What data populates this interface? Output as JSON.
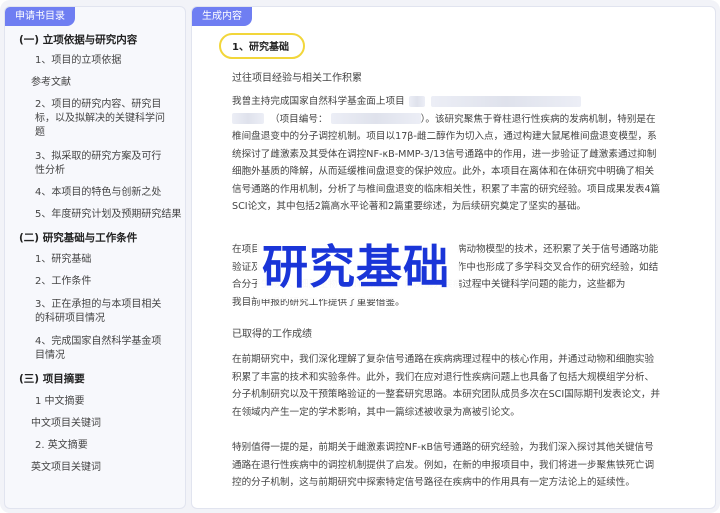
{
  "sidebar": {
    "tab_label": "申请书目录",
    "items": [
      {
        "text": "(一) 立项依据与研究内容",
        "kind": "section"
      },
      {
        "text": "1、项目的立项依据",
        "kind": "sub"
      },
      {
        "text": "参考文献",
        "kind": "ref"
      },
      {
        "text": "2、项目的研究内容、研究目标，以及拟解决的关键科学问题",
        "kind": "sub2"
      },
      {
        "text": "3、拟采取的研究方案及可行性分析",
        "kind": "sub2"
      },
      {
        "text": "4、本项目的特色与创新之处",
        "kind": "sub"
      },
      {
        "text": "5、年度研究计划及预期研究结果",
        "kind": "sub"
      },
      {
        "text": "(二) 研究基础与工作条件",
        "kind": "section"
      },
      {
        "text": "1、研究基础",
        "kind": "sub"
      },
      {
        "text": "2、工作条件",
        "kind": "sub"
      },
      {
        "text": "3、正在承担的与本项目相关的科研项目情况",
        "kind": "sub2"
      },
      {
        "text": "4、完成国家自然科学基金项目情况",
        "kind": "sub2"
      },
      {
        "text": "(三) 项目摘要",
        "kind": "section"
      },
      {
        "text": "1 中文摘要",
        "kind": "sub"
      },
      {
        "text": "中文项目关键词",
        "kind": "ref"
      },
      {
        "text": "2. 英文摘要",
        "kind": "sub"
      },
      {
        "text": "英文项目关键词",
        "kind": "ref"
      }
    ]
  },
  "main": {
    "tab_label": "生成内容",
    "heading": "1、研究基础",
    "subhead1": "过往项目经验与相关工作积累",
    "p1_lines": [
      "我曾主持完成国家自然科学基金面上项目",
      "（项目编号：",
      "）。该研究聚焦于脊柱退行性疾病的发病机制，特别是在",
      "椎间盘退变中的分子调控机制。项目以17β-雌二醇作为切入点，通过构建大鼠尾椎间盘退变模型，系",
      "统探讨了雌激素及其受体在调控NF-κB-MMP-3/13信号通路中的作用，进一步验证了雌激素通过抑制",
      "细胞外基质的降解，从而延缓椎间盘退变的保护效应。此外，本项目在离体和在体研究中明确了相关",
      "信号通路的作用机制，分析了与椎间盘退变的临床相关性，积累了丰富的研究经验。项目成果发表4篇",
      "SCI论文，其中包括2篇高水平论著和2篇重要综述，为后续研究奠定了坚实的基础。"
    ],
    "p2_lines": [
      "在项目",
      "病动物模型的技术，还积累了关于信号通路功能",
      "验证及",
      "作中也形成了多学科交叉合作的研究经验，如结",
      "合分子生物学、细胞生物学和临床医学，解决重大疾病过程中关键科学问题的能力，这些都为",
      "我目前申报的研究工作提供了重要借鉴。"
    ],
    "subhead2": "已取得的工作成绩",
    "p3_lines": [
      "在前期研究中，我们深化理解了复杂信号通路在疾病病理过程中的核心作用，并通过动物和细胞实验",
      "积累了丰富的技术和实验条件。此外，我们在应对退行性疾病问题上也具备了包括大规模组学分析、",
      "分子机制研究以及干预策略验证的一整套研究思路。本研究团队成员多次在SCI国际期刊发表论文，并",
      "在领域内产生一定的学术影响，其中一篇综述被收录为高被引论文。"
    ],
    "p4_lines": [
      "特别值得一提的是，前期关于雌激素调控NF-κB信号通路的研究经验，为我们深入探讨其他关键信号",
      "通路在退行性疾病中的调控机制提供了启发。例如，在新的申报项目中，我们将进一步聚焦铁死亡调",
      "控的分子机制，这与前期研究中探索特定信号路径在疾病中的作用具有一定方法论上的延续性。"
    ]
  },
  "overlay": {
    "text": "研究基础"
  }
}
